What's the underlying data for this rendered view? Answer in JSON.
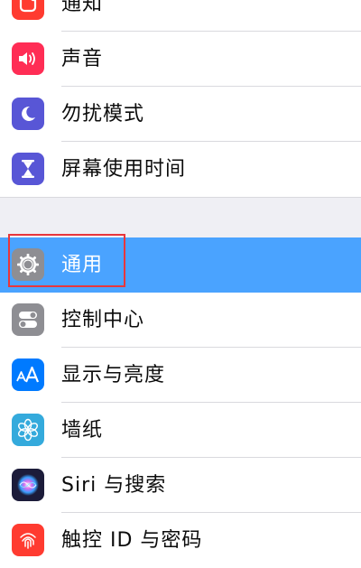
{
  "settings": {
    "group1": [
      {
        "label": "通知",
        "icon": "notifications-icon",
        "color": "#ff3b30"
      },
      {
        "label": "声音",
        "icon": "speaker-icon",
        "color": "#ff2d55"
      },
      {
        "label": "勿扰模式",
        "icon": "moon-icon",
        "color": "#5856d6"
      },
      {
        "label": "屏幕使用时间",
        "icon": "hourglass-icon",
        "color": "#5856d6"
      }
    ],
    "group2": [
      {
        "label": "通用",
        "icon": "gear-icon",
        "color": "#8e8e93",
        "selected": true
      },
      {
        "label": "控制中心",
        "icon": "control-center-icon",
        "color": "#8e8e93"
      },
      {
        "label": "显示与亮度",
        "icon": "display-aa-icon",
        "color": "#007aff"
      },
      {
        "label": "墙纸",
        "icon": "wallpaper-flower-icon",
        "color": "#34aadc"
      },
      {
        "label": "Siri 与搜索",
        "icon": "siri-icon",
        "color": "#1c1c3a"
      },
      {
        "label": "触控 ID 与密码",
        "icon": "fingerprint-icon",
        "color": "#ff3b30"
      }
    ]
  },
  "colors": {
    "background": "#efeff4",
    "selection": "#4aa3ff",
    "highlight_outline": "#e8363c"
  }
}
